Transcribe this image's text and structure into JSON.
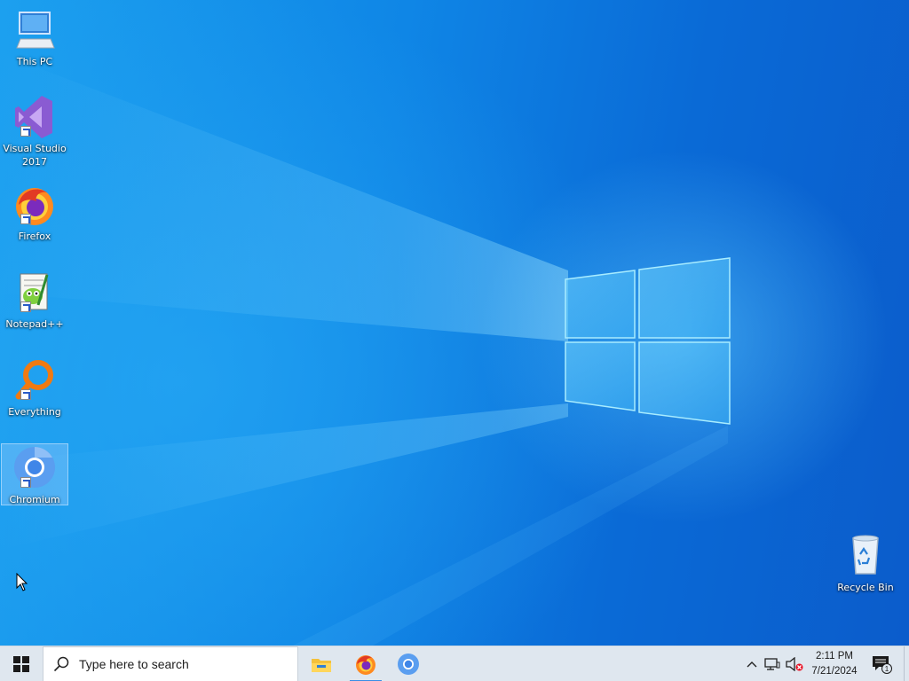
{
  "desktop": {
    "icons": [
      {
        "label": "This PC"
      },
      {
        "label": "Visual Studio 2017"
      },
      {
        "label": "Firefox"
      },
      {
        "label": "Notepad++"
      },
      {
        "label": "Everything"
      },
      {
        "label": "Chromium"
      },
      {
        "label": "Recycle Bin"
      }
    ],
    "selected_icon": "Chromium"
  },
  "taskbar": {
    "search_placeholder": "Type here to search",
    "pinned_apps": [
      "file-explorer-icon",
      "firefox-icon",
      "chromium-icon"
    ],
    "active_app": "firefox-icon",
    "tray_icons": [
      "chevron-up-icon",
      "network-icon",
      "volume-muted-icon"
    ],
    "clock": {
      "time": "2:11 PM",
      "date": "7/21/2024"
    },
    "notification_count": "1"
  },
  "colors": {
    "taskbar_bg": "#dfe7ef",
    "wallpaper_accent": "#0f86e6",
    "active_indicator": "#3a8ee6"
  }
}
